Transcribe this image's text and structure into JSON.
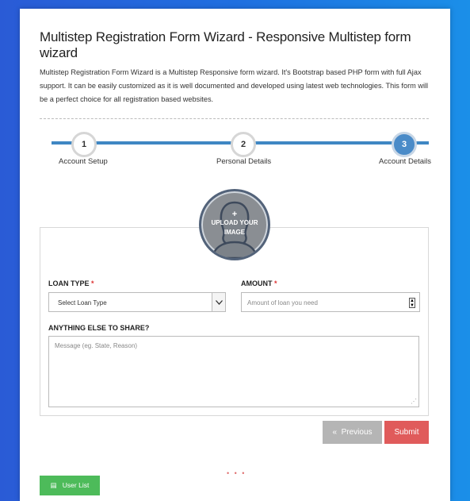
{
  "header": {
    "title": "Multistep Registration Form Wizard - Responsive Multistep form wizard",
    "description": "Multistep Registration Form Wizard is a Multistep Responsive form wizard. It's Bootstrap based PHP form with full Ajax support. It can be easily customized as it is well documented and developed using latest web technologies. This form will be a perfect choice for all registration based websites."
  },
  "steps": [
    {
      "number": "1",
      "label": "Account Setup"
    },
    {
      "number": "2",
      "label": "Personal Details"
    },
    {
      "number": "3",
      "label": "Account Details"
    }
  ],
  "upload": {
    "plus": "+",
    "label": "UPLOAD YOUR IMAGE"
  },
  "form": {
    "loan_type_label": "LOAN TYPE",
    "loan_type_selected": "Select Loan Type",
    "amount_label": "AMOUNT",
    "amount_placeholder": "Amount of loan you need",
    "required_mark": "*",
    "message_label": "ANYTHING ELSE TO SHARE?",
    "message_placeholder": "Message (eg. State, Reason)"
  },
  "buttons": {
    "previous_icon": "«",
    "previous": "Previous",
    "submit": "Submit",
    "user_list": "User List"
  },
  "colors": {
    "step_track": "#3f87c3",
    "active_step": "#4a8bc8",
    "submit": "#e05b5b",
    "previous": "#b5b5b5",
    "user_list": "#4dbb5a"
  }
}
